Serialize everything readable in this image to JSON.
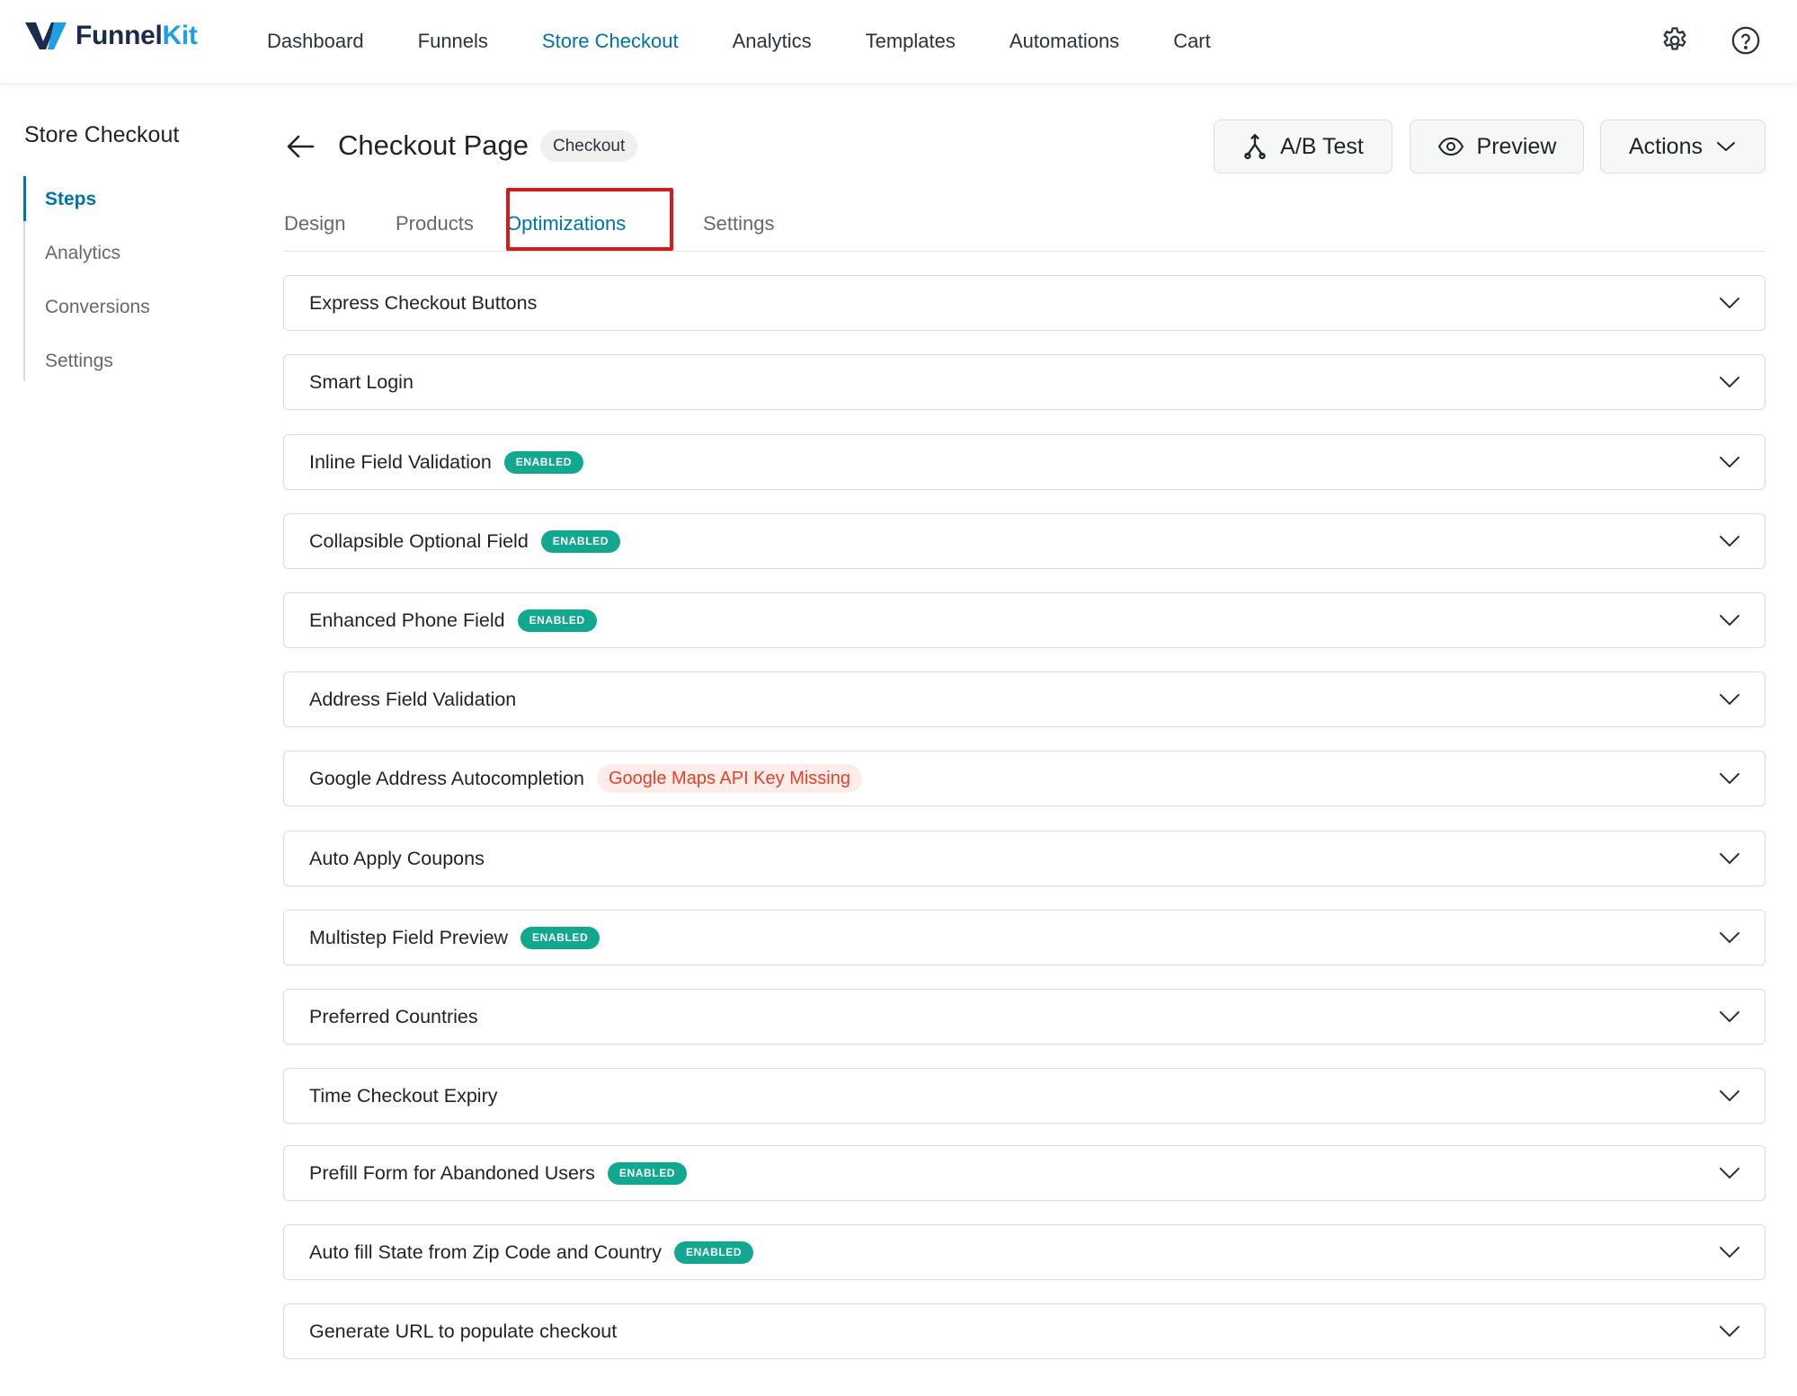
{
  "brand": {
    "name_part1": "Funnel",
    "name_part2": "Kit"
  },
  "topnav": [
    {
      "label": "Dashboard",
      "active": false
    },
    {
      "label": "Funnels",
      "active": false
    },
    {
      "label": "Store Checkout",
      "active": true
    },
    {
      "label": "Analytics",
      "active": false
    },
    {
      "label": "Templates",
      "active": false
    },
    {
      "label": "Automations",
      "active": false
    },
    {
      "label": "Cart",
      "active": false
    }
  ],
  "top_icons": [
    "gear-icon",
    "help-icon"
  ],
  "sidebar": {
    "title": "Store Checkout",
    "items": [
      {
        "label": "Steps",
        "active": true
      },
      {
        "label": "Analytics",
        "active": false
      },
      {
        "label": "Conversions",
        "active": false
      },
      {
        "label": "Settings",
        "active": false
      }
    ]
  },
  "header": {
    "title": "Checkout Page",
    "badge": "Checkout",
    "ab_label": "A/B Test",
    "preview_label": "Preview",
    "actions_label": "Actions"
  },
  "tabs": [
    {
      "label": "Design",
      "active": false
    },
    {
      "label": "Products",
      "active": false
    },
    {
      "label": "Optimizations",
      "active": true
    },
    {
      "label": "Settings",
      "active": false
    }
  ],
  "optimizations": [
    {
      "label": "Express Checkout Buttons",
      "badge": ""
    },
    {
      "label": "Smart Login",
      "badge": ""
    },
    {
      "label": "Inline Field Validation",
      "badge": "ENABLED"
    },
    {
      "label": "Collapsible Optional Field",
      "badge": "ENABLED"
    },
    {
      "label": "Enhanced Phone Field",
      "badge": "ENABLED"
    },
    {
      "label": "Address Field Validation",
      "badge": ""
    },
    {
      "label": "Google Address Autocompletion",
      "warning": "Google Maps API Key Missing"
    },
    {
      "label": "Auto Apply Coupons",
      "badge": ""
    },
    {
      "label": "Multistep Field Preview",
      "badge": "ENABLED"
    },
    {
      "label": "Preferred Countries",
      "badge": ""
    },
    {
      "label": "Time Checkout Expiry",
      "badge": ""
    },
    {
      "label": "Prefill Form for Abandoned Users",
      "badge": "ENABLED"
    },
    {
      "label": "Auto fill State from Zip Code and Country",
      "badge": "ENABLED"
    },
    {
      "label": "Generate URL to populate checkout",
      "badge": ""
    }
  ],
  "colors": {
    "accent": "#0073aa",
    "enabled_badge": "#12a88f",
    "warning_text": "#e0432b",
    "highlight_box": "#d61a1a"
  }
}
